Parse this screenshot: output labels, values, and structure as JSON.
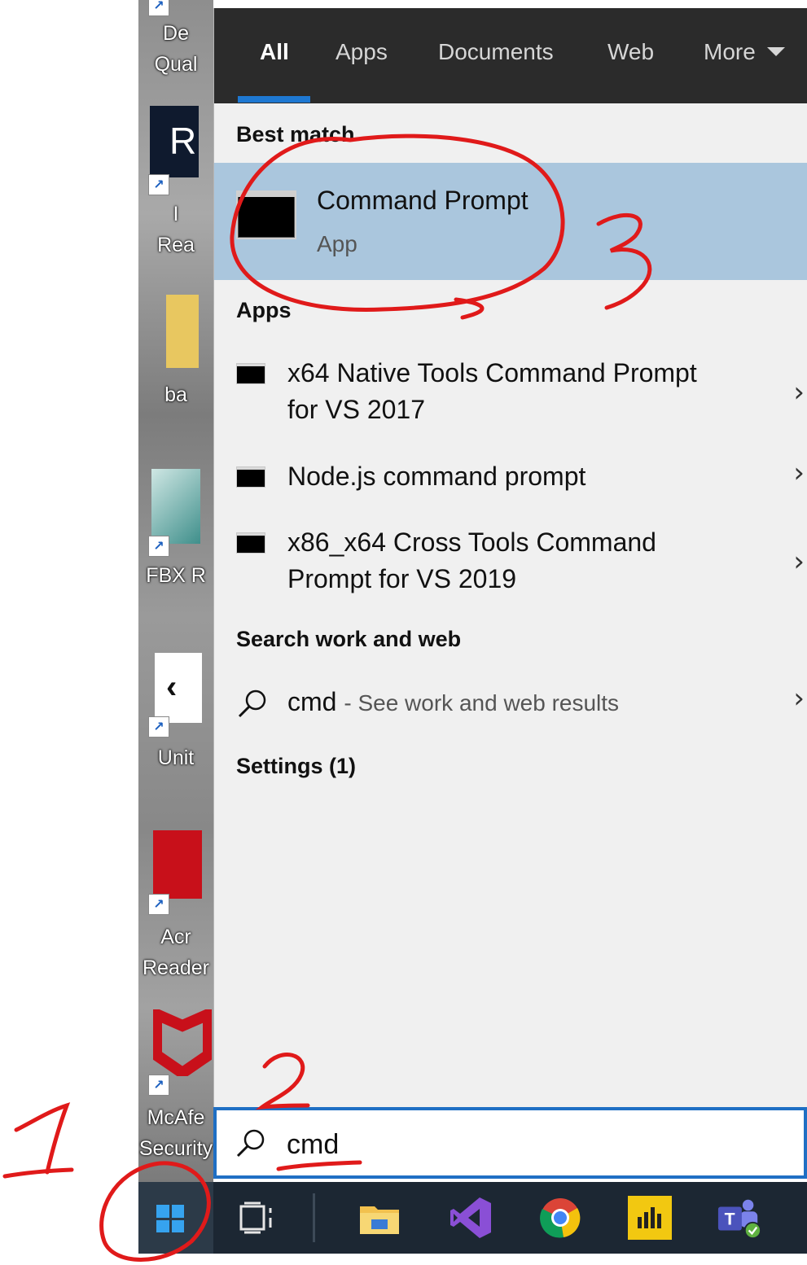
{
  "desktop_icons": [
    {
      "label": "De\nQual",
      "kind": "doc"
    },
    {
      "label": "I\nRea",
      "kind": "reader"
    },
    {
      "label": "ba",
      "kind": "folder"
    },
    {
      "label": "FBX R",
      "kind": "fbx"
    },
    {
      "label": "Unit",
      "kind": "unity"
    },
    {
      "label": "Acr\nReader",
      "kind": "acrobat"
    },
    {
      "label": "McAfe\nSecurity",
      "kind": "mcafee"
    }
  ],
  "tabs": [
    {
      "label": "All",
      "active": true
    },
    {
      "label": "Apps"
    },
    {
      "label": "Documents"
    },
    {
      "label": "Web"
    },
    {
      "label": "More"
    }
  ],
  "best_match": {
    "heading": "Best match",
    "title": "Command Prompt",
    "subtitle": "App",
    "icon": "command-prompt-icon"
  },
  "apps": {
    "heading": "Apps",
    "items": [
      {
        "label": "x64 Native Tools Command Prompt\nfor VS 2017"
      },
      {
        "label": "Node.js command prompt"
      },
      {
        "label": "x86_x64 Cross Tools Command\nPrompt for VS 2019"
      }
    ]
  },
  "search_web": {
    "heading": "Search work and web",
    "query": "cmd",
    "hint": "- See work and web results"
  },
  "settings": {
    "heading": "Settings (1)"
  },
  "search_box": {
    "value": "cmd"
  },
  "taskbar": {
    "items": [
      "task-view",
      "file-explorer",
      "visual-studio",
      "chrome",
      "power-bi",
      "teams"
    ]
  },
  "annotations": {
    "one": "1",
    "two": "2",
    "three": "3",
    "color": "#e01a1a"
  },
  "colors": {
    "accent": "#1e78d2",
    "highlight": "#aac6dd",
    "tabbar": "#2b2b2b"
  }
}
